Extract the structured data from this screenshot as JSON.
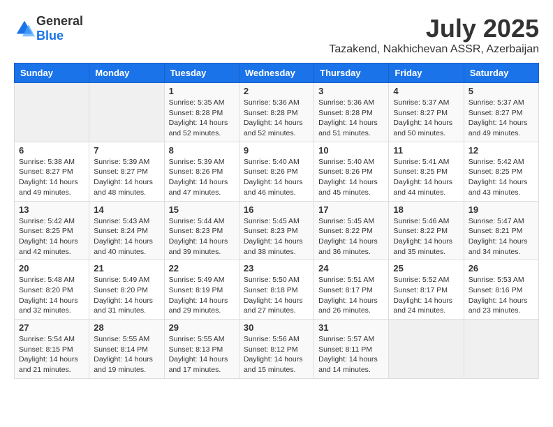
{
  "logo": {
    "text_general": "General",
    "text_blue": "Blue"
  },
  "title": {
    "month": "July 2025",
    "location": "Tazakend, Nakhichevan ASSR, Azerbaijan"
  },
  "weekdays": [
    "Sunday",
    "Monday",
    "Tuesday",
    "Wednesday",
    "Thursday",
    "Friday",
    "Saturday"
  ],
  "weeks": [
    [
      {
        "day": "",
        "sunrise": "",
        "sunset": "",
        "daylight": "",
        "empty": true
      },
      {
        "day": "",
        "sunrise": "",
        "sunset": "",
        "daylight": "",
        "empty": true
      },
      {
        "day": "1",
        "sunrise": "Sunrise: 5:35 AM",
        "sunset": "Sunset: 8:28 PM",
        "daylight": "Daylight: 14 hours and 52 minutes."
      },
      {
        "day": "2",
        "sunrise": "Sunrise: 5:36 AM",
        "sunset": "Sunset: 8:28 PM",
        "daylight": "Daylight: 14 hours and 52 minutes."
      },
      {
        "day": "3",
        "sunrise": "Sunrise: 5:36 AM",
        "sunset": "Sunset: 8:28 PM",
        "daylight": "Daylight: 14 hours and 51 minutes."
      },
      {
        "day": "4",
        "sunrise": "Sunrise: 5:37 AM",
        "sunset": "Sunset: 8:27 PM",
        "daylight": "Daylight: 14 hours and 50 minutes."
      },
      {
        "day": "5",
        "sunrise": "Sunrise: 5:37 AM",
        "sunset": "Sunset: 8:27 PM",
        "daylight": "Daylight: 14 hours and 49 minutes."
      }
    ],
    [
      {
        "day": "6",
        "sunrise": "Sunrise: 5:38 AM",
        "sunset": "Sunset: 8:27 PM",
        "daylight": "Daylight: 14 hours and 49 minutes."
      },
      {
        "day": "7",
        "sunrise": "Sunrise: 5:39 AM",
        "sunset": "Sunset: 8:27 PM",
        "daylight": "Daylight: 14 hours and 48 minutes."
      },
      {
        "day": "8",
        "sunrise": "Sunrise: 5:39 AM",
        "sunset": "Sunset: 8:26 PM",
        "daylight": "Daylight: 14 hours and 47 minutes."
      },
      {
        "day": "9",
        "sunrise": "Sunrise: 5:40 AM",
        "sunset": "Sunset: 8:26 PM",
        "daylight": "Daylight: 14 hours and 46 minutes."
      },
      {
        "day": "10",
        "sunrise": "Sunrise: 5:40 AM",
        "sunset": "Sunset: 8:26 PM",
        "daylight": "Daylight: 14 hours and 45 minutes."
      },
      {
        "day": "11",
        "sunrise": "Sunrise: 5:41 AM",
        "sunset": "Sunset: 8:25 PM",
        "daylight": "Daylight: 14 hours and 44 minutes."
      },
      {
        "day": "12",
        "sunrise": "Sunrise: 5:42 AM",
        "sunset": "Sunset: 8:25 PM",
        "daylight": "Daylight: 14 hours and 43 minutes."
      }
    ],
    [
      {
        "day": "13",
        "sunrise": "Sunrise: 5:42 AM",
        "sunset": "Sunset: 8:25 PM",
        "daylight": "Daylight: 14 hours and 42 minutes."
      },
      {
        "day": "14",
        "sunrise": "Sunrise: 5:43 AM",
        "sunset": "Sunset: 8:24 PM",
        "daylight": "Daylight: 14 hours and 40 minutes."
      },
      {
        "day": "15",
        "sunrise": "Sunrise: 5:44 AM",
        "sunset": "Sunset: 8:23 PM",
        "daylight": "Daylight: 14 hours and 39 minutes."
      },
      {
        "day": "16",
        "sunrise": "Sunrise: 5:45 AM",
        "sunset": "Sunset: 8:23 PM",
        "daylight": "Daylight: 14 hours and 38 minutes."
      },
      {
        "day": "17",
        "sunrise": "Sunrise: 5:45 AM",
        "sunset": "Sunset: 8:22 PM",
        "daylight": "Daylight: 14 hours and 36 minutes."
      },
      {
        "day": "18",
        "sunrise": "Sunrise: 5:46 AM",
        "sunset": "Sunset: 8:22 PM",
        "daylight": "Daylight: 14 hours and 35 minutes."
      },
      {
        "day": "19",
        "sunrise": "Sunrise: 5:47 AM",
        "sunset": "Sunset: 8:21 PM",
        "daylight": "Daylight: 14 hours and 34 minutes."
      }
    ],
    [
      {
        "day": "20",
        "sunrise": "Sunrise: 5:48 AM",
        "sunset": "Sunset: 8:20 PM",
        "daylight": "Daylight: 14 hours and 32 minutes."
      },
      {
        "day": "21",
        "sunrise": "Sunrise: 5:49 AM",
        "sunset": "Sunset: 8:20 PM",
        "daylight": "Daylight: 14 hours and 31 minutes."
      },
      {
        "day": "22",
        "sunrise": "Sunrise: 5:49 AM",
        "sunset": "Sunset: 8:19 PM",
        "daylight": "Daylight: 14 hours and 29 minutes."
      },
      {
        "day": "23",
        "sunrise": "Sunrise: 5:50 AM",
        "sunset": "Sunset: 8:18 PM",
        "daylight": "Daylight: 14 hours and 27 minutes."
      },
      {
        "day": "24",
        "sunrise": "Sunrise: 5:51 AM",
        "sunset": "Sunset: 8:17 PM",
        "daylight": "Daylight: 14 hours and 26 minutes."
      },
      {
        "day": "25",
        "sunrise": "Sunrise: 5:52 AM",
        "sunset": "Sunset: 8:17 PM",
        "daylight": "Daylight: 14 hours and 24 minutes."
      },
      {
        "day": "26",
        "sunrise": "Sunrise: 5:53 AM",
        "sunset": "Sunset: 8:16 PM",
        "daylight": "Daylight: 14 hours and 23 minutes."
      }
    ],
    [
      {
        "day": "27",
        "sunrise": "Sunrise: 5:54 AM",
        "sunset": "Sunset: 8:15 PM",
        "daylight": "Daylight: 14 hours and 21 minutes."
      },
      {
        "day": "28",
        "sunrise": "Sunrise: 5:55 AM",
        "sunset": "Sunset: 8:14 PM",
        "daylight": "Daylight: 14 hours and 19 minutes."
      },
      {
        "day": "29",
        "sunrise": "Sunrise: 5:55 AM",
        "sunset": "Sunset: 8:13 PM",
        "daylight": "Daylight: 14 hours and 17 minutes."
      },
      {
        "day": "30",
        "sunrise": "Sunrise: 5:56 AM",
        "sunset": "Sunset: 8:12 PM",
        "daylight": "Daylight: 14 hours and 15 minutes."
      },
      {
        "day": "31",
        "sunrise": "Sunrise: 5:57 AM",
        "sunset": "Sunset: 8:11 PM",
        "daylight": "Daylight: 14 hours and 14 minutes."
      },
      {
        "day": "",
        "sunrise": "",
        "sunset": "",
        "daylight": "",
        "empty": true
      },
      {
        "day": "",
        "sunrise": "",
        "sunset": "",
        "daylight": "",
        "empty": true
      }
    ]
  ]
}
